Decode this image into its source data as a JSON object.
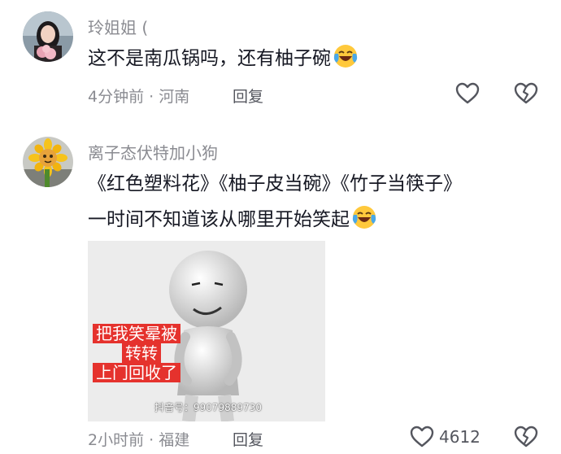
{
  "comments": [
    {
      "username": "玲姐姐 (",
      "text_lines": [
        "这不是南瓜锅吗，还有柚子碗"
      ],
      "time": "4分钟前",
      "location": "河南",
      "reply_label": "回复",
      "likes": "",
      "emoji": "laughing-crying-emoji"
    },
    {
      "username": "离子态伏特加小狗",
      "text_lines": [
        "《红色塑料花》《柚子皮当碗》《竹子当筷子》",
        "一时间不知道该从哪里开始笑起"
      ],
      "time": "2小时前",
      "location": "福建",
      "reply_label": "回复",
      "likes": "4612",
      "emoji": "laughing-crying-emoji",
      "image": {
        "caption_lines": [
          "把我笑晕被",
          "转转",
          "上门回收了"
        ],
        "watermark": "抖音号：99079889730"
      }
    }
  ],
  "separator": "·",
  "colors": {
    "meta": "#8a8b91",
    "text": "#161823",
    "caption_bg": "#e5322d"
  }
}
